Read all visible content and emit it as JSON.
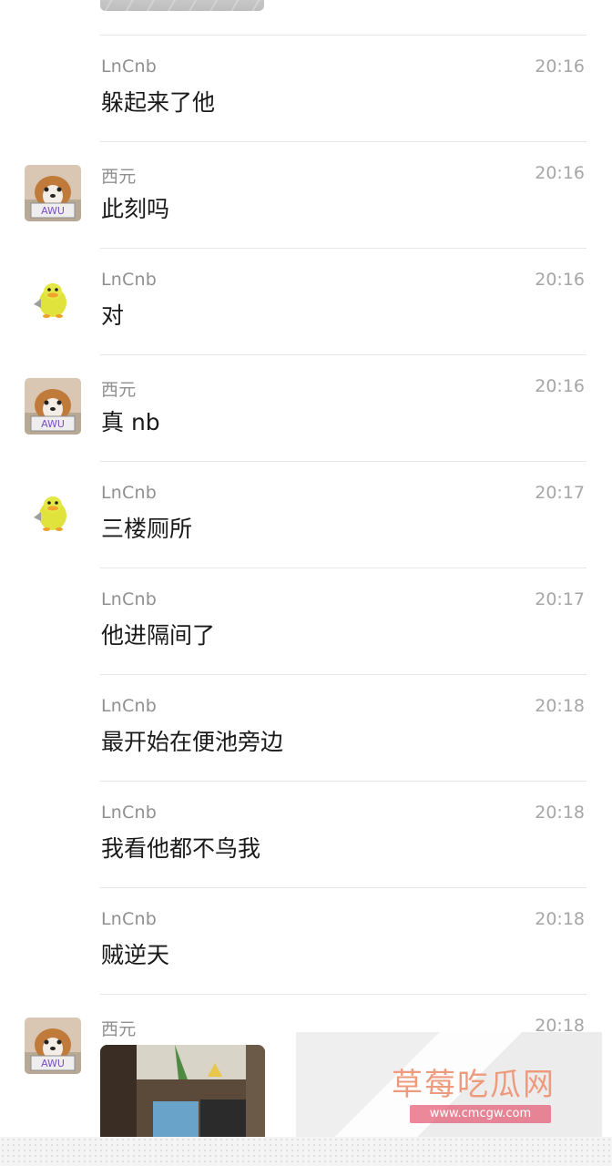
{
  "chat": {
    "messages": [
      {
        "sender": "LnCnb",
        "time": "20:16",
        "text": "躲起来了他",
        "avatar": "none"
      },
      {
        "sender": "西元",
        "time": "20:16",
        "text": "此刻吗",
        "avatar": "dog-avatar"
      },
      {
        "sender": "LnCnb",
        "time": "20:16",
        "text": "对",
        "avatar": "duck-avatar"
      },
      {
        "sender": "西元",
        "time": "20:16",
        "text": "真 nb",
        "avatar": "dog-avatar"
      },
      {
        "sender": "LnCnb",
        "time": "20:17",
        "text": "三楼厕所",
        "avatar": "duck-avatar"
      },
      {
        "sender": "LnCnb",
        "time": "20:17",
        "text": "他进隔间了",
        "avatar": "none"
      },
      {
        "sender": "LnCnb",
        "time": "20:18",
        "text": "最开始在便池旁边",
        "avatar": "none"
      },
      {
        "sender": "LnCnb",
        "time": "20:18",
        "text": "我看他都不鸟我",
        "avatar": "none"
      },
      {
        "sender": "LnCnb",
        "time": "20:18",
        "text": "贼逆天",
        "avatar": "none"
      },
      {
        "sender": "西元",
        "time": "20:18",
        "text": "",
        "avatar": "dog-avatar",
        "has_image": true
      }
    ]
  },
  "watermark": {
    "title": "草莓吃瓜网",
    "url": "www.cmcgw.com"
  }
}
